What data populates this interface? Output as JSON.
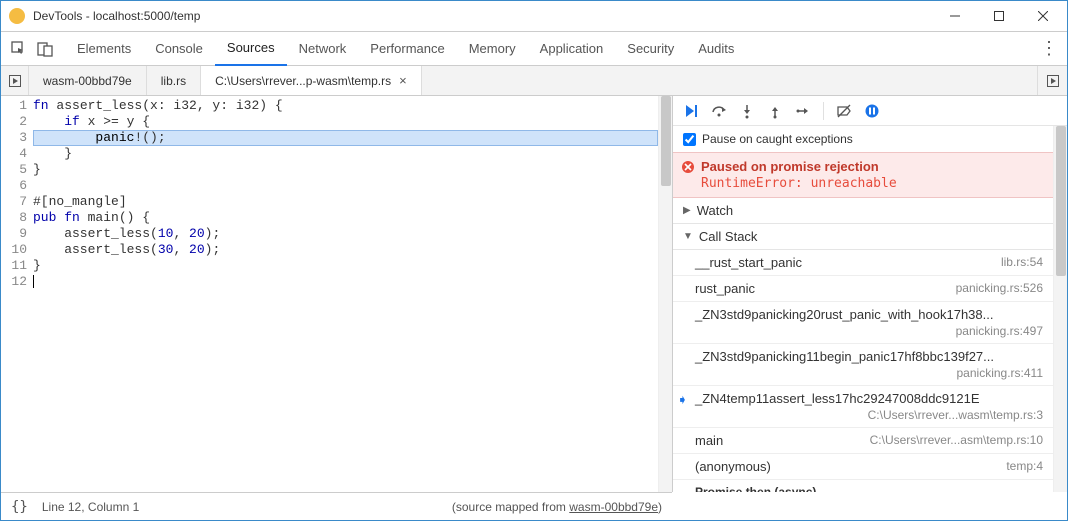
{
  "window": {
    "title": "DevTools - localhost:5000/temp"
  },
  "mainTabs": [
    "Elements",
    "Console",
    "Sources",
    "Network",
    "Performance",
    "Memory",
    "Application",
    "Security",
    "Audits"
  ],
  "mainTabActive": 2,
  "sourceTabs": [
    {
      "label": "wasm-00bbd79e",
      "closable": false
    },
    {
      "label": "lib.rs",
      "closable": false
    },
    {
      "label": "C:\\Users\\rrever...p-wasm\\temp.rs",
      "closable": true
    }
  ],
  "sourceTabActive": 2,
  "code": {
    "lineCount": 12,
    "highlightLine": 3,
    "lines": [
      "fn assert_less(x: i32, y: i32) {",
      "    if x >= y {",
      "        panic!();",
      "    }",
      "}",
      "",
      "#[no_mangle]",
      "pub fn main() {",
      "    assert_less(10, 20);",
      "    assert_less(30, 20);",
      "}",
      ""
    ]
  },
  "checkbox": {
    "label": "Pause on caught exceptions",
    "checked": true
  },
  "paused": {
    "title": "Paused on promise rejection",
    "detail": "RuntimeError: unreachable"
  },
  "watch": {
    "label": "Watch"
  },
  "callstack": {
    "label": "Call Stack",
    "frames": [
      {
        "fn": "__rust_start_panic",
        "loc": "lib.rs:54",
        "twoLine": false
      },
      {
        "fn": "rust_panic",
        "loc": "panicking.rs:526",
        "twoLine": false
      },
      {
        "fn": "_ZN3std9panicking20rust_panic_with_hook17h38...",
        "loc": "panicking.rs:497",
        "twoLine": true
      },
      {
        "fn": "_ZN3std9panicking11begin_panic17hf8bbc139f27...",
        "loc": "panicking.rs:411",
        "twoLine": true
      },
      {
        "fn": "_ZN4temp11assert_less17hc29247008ddc9121E",
        "loc": "C:\\Users\\rrever...wasm\\temp.rs:3",
        "twoLine": true,
        "current": true
      },
      {
        "fn": "main",
        "loc": "C:\\Users\\rrever...asm\\temp.rs:10",
        "twoLine": false
      },
      {
        "fn": "(anonymous)",
        "loc": "temp:4",
        "twoLine": false
      }
    ],
    "async": "Promise.then (async)"
  },
  "status": {
    "pos": "Line 12, Column 1",
    "mappedPrefix": "(source mapped from ",
    "mappedFile": "wasm-00bbd79e",
    "mappedSuffix": ")"
  }
}
